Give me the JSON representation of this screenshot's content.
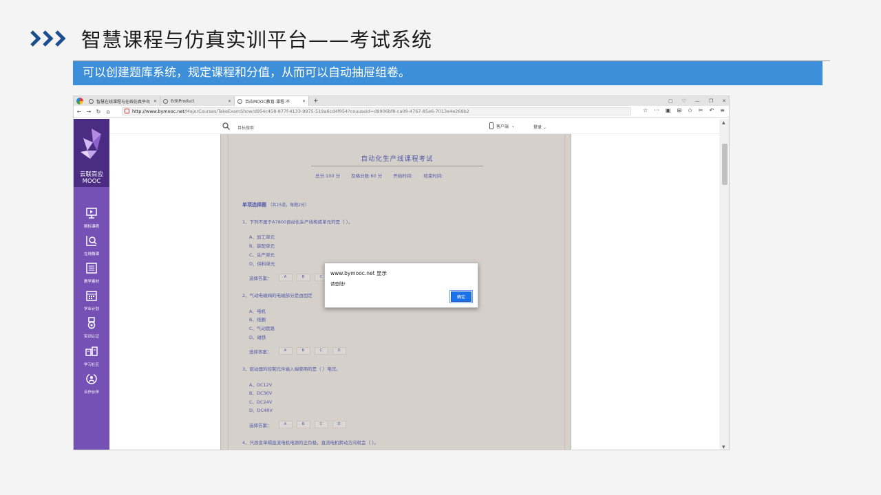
{
  "slide": {
    "title": "智慧课程与仿真实训平台——考试系统",
    "banner": "可以创建题库系统，规定课程和分值，从而可以自动抽屉组卷。"
  },
  "browser": {
    "tabs": [
      {
        "label": "智慧在线课程与在线仿真平台",
        "active": false
      },
      {
        "label": "EditProduct",
        "active": false
      },
      {
        "label": "百应MOOC教育-课程-不",
        "active": true
      }
    ],
    "url_domain": "http://www.bymooc.net",
    "url_path": "/MajorCourses/TakeExamShow/d954c458-877f-4133-9975-519a6cd4f954?couuseid=d9906bf8-ca09-4767-85e6-7013e4e269b2"
  },
  "site": {
    "brand": "云联百应MOOC",
    "search_placeholder": "目标搜索",
    "client_label": "客户端",
    "login_label": "登录",
    "nav": [
      {
        "label": "精标课程",
        "icon": "monitor-icon"
      },
      {
        "label": "在线微课",
        "icon": "chart-search-icon"
      },
      {
        "label": "教学素材",
        "icon": "list-icon"
      },
      {
        "label": "学业计划",
        "icon": "calendar-icon"
      },
      {
        "label": "实训认证",
        "icon": "medal-icon"
      },
      {
        "label": "学习社区",
        "icon": "community-icon"
      },
      {
        "label": "合作伙伴",
        "icon": "partner-icon"
      }
    ]
  },
  "exam": {
    "title": "自动化生产线课程考试",
    "total": "总分:100 分",
    "pass": "及格分数:60 分",
    "start": "开始时间:",
    "end": "结束时间:",
    "section": "单项选择题",
    "section_note": "（共15道，每题2分）",
    "answer_label": "选择答案：",
    "choices": [
      "A",
      "B",
      "C",
      "D"
    ],
    "questions": [
      {
        "text": "1、下列不属于A7800自动化生产线构成单元的是（ ）。",
        "options": [
          "A、加工单元",
          "B、装配单元",
          "C、生产单元",
          "D、供料单元"
        ]
      },
      {
        "text": "2、气动电磁阀的电磁部分是由固定",
        "options": [
          "A、电机",
          "B、线圈",
          "C、气动管路",
          "D、磁铁"
        ]
      },
      {
        "text": "3、驱动器的控制元件输入端使用的是（ ）电压。",
        "options": [
          "A、DC12V",
          "B、DC36V",
          "C、DC24V",
          "D、DC48V"
        ]
      },
      {
        "text": "4、只改变单隔直流电机电源的正负极，直流电机转动方向就会（ ）。",
        "options": []
      }
    ]
  },
  "dialog": {
    "title": "www.bymooc.net 显示",
    "message": "请登陆!",
    "ok": "确定"
  }
}
